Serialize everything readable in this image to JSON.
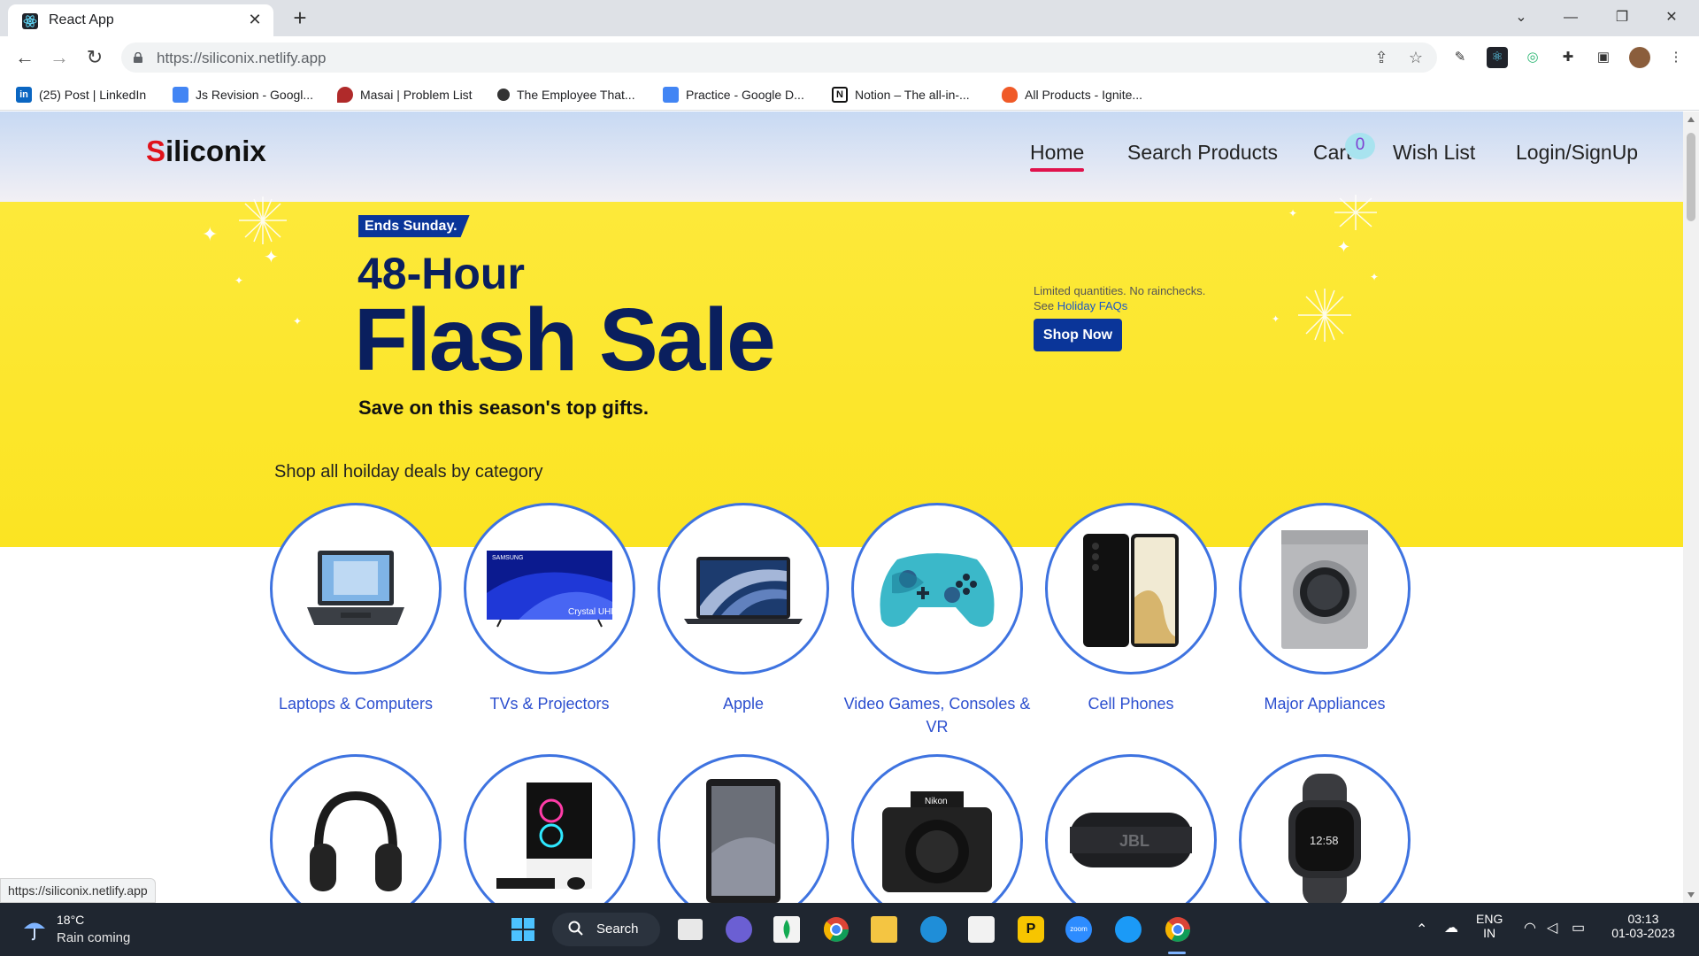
{
  "browser": {
    "tab_title": "React App",
    "tab_close": "✕",
    "new_tab": "+",
    "url": "https://siliconix.netlify.app",
    "window_controls": {
      "minimize": "—",
      "restore": "❐",
      "close": "✕",
      "tab_search": "⌄"
    }
  },
  "bookmarks": [
    {
      "label": "(25) Post | LinkedIn",
      "icon": "linkedin-icon",
      "color": "#0a66c2"
    },
    {
      "label": "Js Revision - Googl...",
      "icon": "google-docs-icon",
      "color": "#4285f4"
    },
    {
      "label": "Masai | Problem List",
      "icon": "masai-icon",
      "color": "#b02a2a"
    },
    {
      "label": "The Employee That...",
      "icon": "medium-icon",
      "color": "#333333"
    },
    {
      "label": "Practice - Google D...",
      "icon": "google-docs-icon",
      "color": "#4285f4"
    },
    {
      "label": "Notion – The all-in-...",
      "icon": "notion-icon",
      "color": "#111111"
    },
    {
      "label": "All Products - Ignite...",
      "icon": "fire-icon",
      "color": "#f05a28"
    }
  ],
  "site": {
    "logo_first": "S",
    "logo_rest": "iliconix",
    "nav": {
      "home": "Home",
      "search": "Search Products",
      "cart": "Cart",
      "cart_count": "0",
      "wishlist": "Wish List",
      "login": "Login/SignUp"
    },
    "hero": {
      "badge": "Ends Sunday.",
      "title_small": "48-Hour",
      "title_big": "Flash Sale",
      "subtitle": "Save on this season's top gifts.",
      "note_line1": "Limited quantities. No rainchecks.",
      "note_see": "See",
      "note_link": "Holiday FAQs",
      "cta": "Shop Now"
    },
    "category_heading": "Shop all hoilday deals by category",
    "categories": [
      {
        "label": "Laptops & Computers",
        "icon": "laptop-icon"
      },
      {
        "label": "TVs & Projectors",
        "icon": "tv-icon"
      },
      {
        "label": "Apple",
        "icon": "macbook-icon"
      },
      {
        "label": "Video Games, Consoles & VR",
        "icon": "gamepad-icon"
      },
      {
        "label": "Cell Phones",
        "icon": "phone-icon"
      },
      {
        "label": "Major Appliances",
        "icon": "washer-icon"
      },
      {
        "label": "",
        "icon": "headphones-icon"
      },
      {
        "label": "",
        "icon": "desktop-pc-icon"
      },
      {
        "label": "",
        "icon": "tablet-icon"
      },
      {
        "label": "",
        "icon": "camera-icon"
      },
      {
        "label": "",
        "icon": "speaker-icon"
      },
      {
        "label": "",
        "icon": "smartwatch-icon"
      }
    ],
    "tv_brand": "SAMSUNG",
    "tv_caption": "Crystal UHD",
    "speaker_brand": "JBL",
    "camera_brand": "Nikon",
    "watch_time": "12:58"
  },
  "status_url": "https://siliconix.netlify.app",
  "taskbar": {
    "temperature": "18°C",
    "weather": "Rain coming",
    "search_label": "Search",
    "language_line1": "ENG",
    "language_line2": "IN",
    "time": "03:13",
    "date": "01-03-2023",
    "zoom_label": "zoom"
  },
  "colors": {
    "accent_blue": "#0a3599",
    "hero_yellow": "#fde93a",
    "logo_red": "#e0121b",
    "category_ring": "#3e73e0",
    "category_text": "#2c4fcf",
    "nav_active": "#e0124c"
  }
}
